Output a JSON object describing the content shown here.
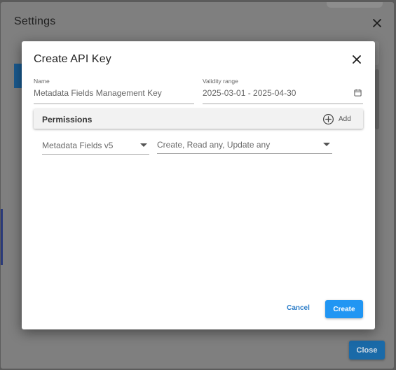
{
  "settings": {
    "title": "Settings",
    "close_icon": "close-icon",
    "close_button_label": "Close"
  },
  "dialog": {
    "title": "Create API Key",
    "close_icon": "close-icon",
    "name_field": {
      "label": "Name",
      "value": "Metadata Fields Management Key"
    },
    "validity_field": {
      "label": "Validity range",
      "value": "2025-03-01 - 2025-04-30",
      "icon": "calendar-icon"
    },
    "permissions": {
      "title": "Permissions",
      "add_icon": "add-circle-icon",
      "add_label": "Add",
      "rows": [
        {
          "resource": "Metadata Fields v5",
          "actions": "Create, Read any, Update any"
        }
      ]
    },
    "cancel_label": "Cancel",
    "create_label": "Create"
  },
  "colors": {
    "primary": "#2196f3",
    "link": "#2f7fc9",
    "overlay": "#5b5b5b"
  }
}
